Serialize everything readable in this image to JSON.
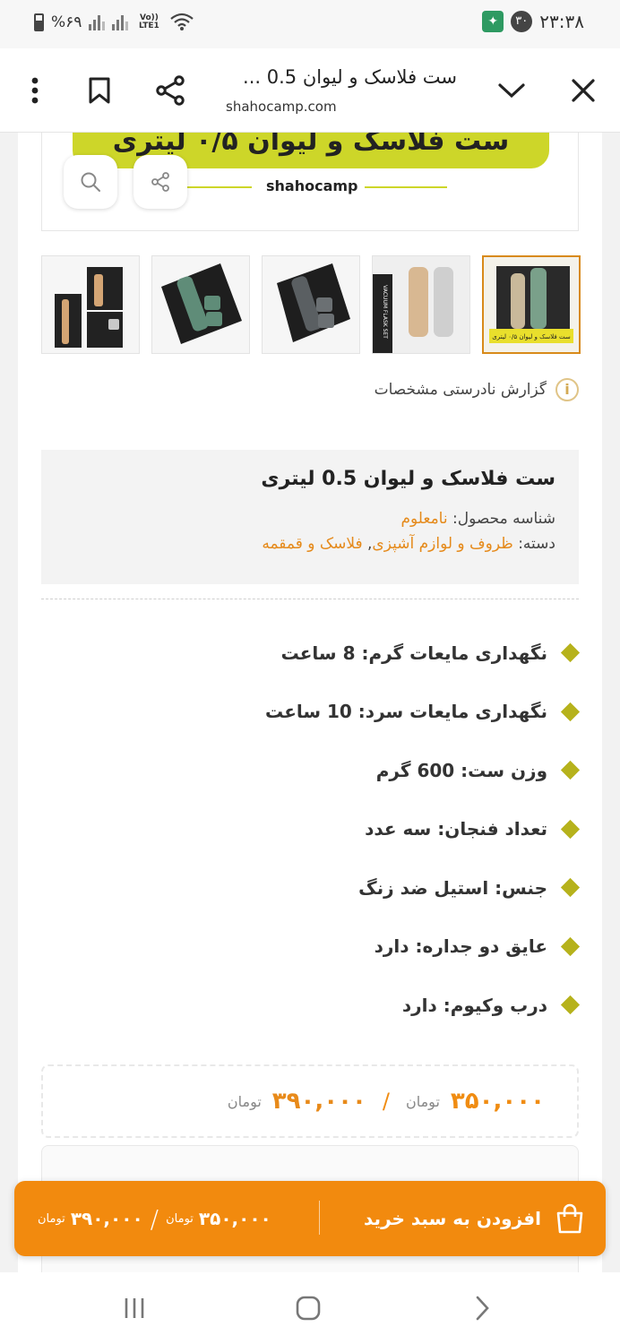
{
  "status_bar": {
    "battery_text": "%۶۹",
    "network_label": "Vo)) LTE1",
    "notification_count": "۳۰",
    "time": "۲۳:۳۸"
  },
  "browser": {
    "title": "ست فلاسک و لیوان 0.5 ...",
    "url": "shahocamp.com"
  },
  "banner": {
    "headline": "ست فلاسک و لیوان ۰/۵ لیتری",
    "brand": "shahocamp"
  },
  "thumbnails": [
    {
      "label": "thumb-1",
      "caption": "ست فلاسک و لیوان ۰/۵ لیتری",
      "active": true
    },
    {
      "label": "thumb-2",
      "caption": "VACUUM FLASK SET",
      "active": false
    },
    {
      "label": "thumb-3",
      "caption": "",
      "active": false
    },
    {
      "label": "thumb-4",
      "caption": "",
      "active": false
    },
    {
      "label": "thumb-5",
      "caption": "",
      "active": false
    }
  ],
  "report": {
    "icon": "info-icon",
    "text": "گزارش نادرستی مشخصات"
  },
  "product": {
    "title": "ست فلاسک و لیوان 0.5 لیتری",
    "sku_label": "شناسه محصول:",
    "sku_value": "نامعلوم",
    "category_label": "دسته:",
    "category_1": "ظروف و لوازم آشپزی",
    "category_sep": ",",
    "category_2": "فلاسک و قمقمه"
  },
  "features": [
    "نگهداری مایعات گرم:  8 ساعت",
    "نگهداری مایعات سرد: 10 ساعت",
    "وزن ست: 600 گرم",
    "تعداد فنجان: سه عدد",
    "جنس: استیل ضد زنگ",
    "عایق دو جداره: دارد",
    "درب وکیوم: دارد"
  ],
  "price": {
    "new": "۳۵۰,۰۰۰",
    "old": "۳۹۰,۰۰۰",
    "unit": "تومان",
    "separator": "/"
  },
  "cart_bar": {
    "label": "افزودن به سبد خرید",
    "new": "۳۵۰,۰۰۰",
    "old": "۳۹۰,۰۰۰",
    "unit": "تومان",
    "separator": "/"
  },
  "colors": {
    "accent": "#f28a0e",
    "bullet": "#b6b21c",
    "banner": "#cdd629"
  }
}
